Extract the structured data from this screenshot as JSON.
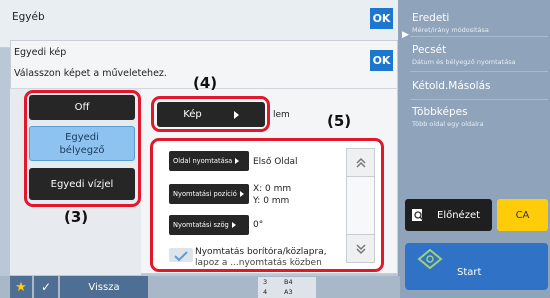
{
  "outer": {
    "title": "Egyéb",
    "ok": "OK"
  },
  "dialog": {
    "title": "Egyedi kép",
    "ok": "OK",
    "instruction": "Válasszon képet a műveletehez."
  },
  "left_buttons": {
    "off": "Off",
    "stamp_line1": "Egyedi",
    "stamp_line2": "bélyegző",
    "watermark": "Egyedi vízjel"
  },
  "image_select": {
    "label": "Kép",
    "suffix": "lem"
  },
  "settings": {
    "page_print": {
      "label": "Oldal nyomtatása",
      "value": "Első Oldal"
    },
    "position": {
      "label": "Nyomtatási pozíció",
      "value_x": "X: 0 mm",
      "value_y": "Y: 0 mm"
    },
    "angle": {
      "label": "Nyomtatási szög",
      "value": "0°"
    },
    "cover": {
      "line1": "Nyomtatás borítóra/közlapra,",
      "line2": "lapoz a ...nyomtatás közben"
    }
  },
  "callouts": {
    "c3": "(3)",
    "c4": "(4)",
    "c5": "(5)"
  },
  "right_panel": {
    "items": [
      {
        "title": "Eredeti",
        "subtitle": "Méret/irány módosítása"
      },
      {
        "title": "Pecsét",
        "subtitle": "Dátum és bélyegző nyomtatása"
      },
      {
        "title": "Kétold.Másolás",
        "subtitle": ""
      },
      {
        "title": "Többképes",
        "subtitle": "Több oldal egy oldalra"
      }
    ],
    "preview": "Előnézet",
    "ca": "CA",
    "start": "Start"
  },
  "bottom": {
    "back": "Vissza",
    "tray_row1": "B4",
    "tray_row2": "A3",
    "tray_num1": "3",
    "tray_num2": "4"
  },
  "colors": {
    "accent_blue": "#1d76d0",
    "highlight_red": "#e2172c",
    "ca_yellow": "#ffcc0a",
    "start_blue": "#2f72c6"
  }
}
